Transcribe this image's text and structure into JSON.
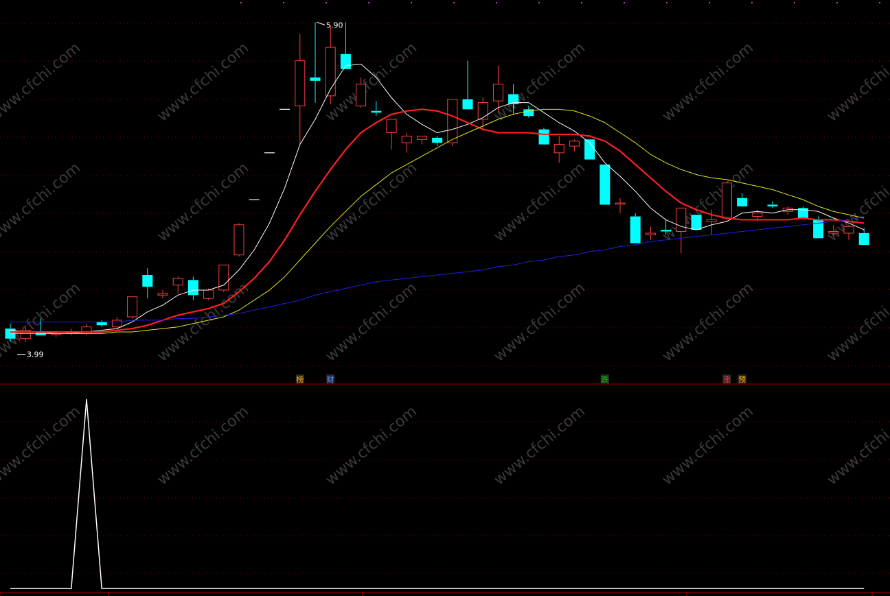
{
  "chart_data": [
    {
      "type": "candlestick",
      "title": "",
      "ylim": [
        3.8,
        6.0
      ],
      "candles": [
        {
          "o": 4.07,
          "h": 4.1,
          "l": 3.99,
          "c": 4.01
        },
        {
          "o": 4.01,
          "h": 4.08,
          "l": 3.99,
          "c": 4.06
        },
        {
          "o": 4.05,
          "h": 4.13,
          "l": 4.03,
          "c": 4.03
        },
        {
          "o": 4.04,
          "h": 4.06,
          "l": 4.02,
          "c": 4.04
        },
        {
          "o": 4.05,
          "h": 4.07,
          "l": 4.03,
          "c": 4.05
        },
        {
          "o": 4.04,
          "h": 4.1,
          "l": 4.03,
          "c": 4.08
        },
        {
          "o": 4.11,
          "h": 4.12,
          "l": 4.08,
          "c": 4.09
        },
        {
          "o": 4.08,
          "h": 4.14,
          "l": 4.07,
          "c": 4.12
        },
        {
          "o": 4.14,
          "h": 4.26,
          "l": 4.13,
          "c": 4.26
        },
        {
          "o": 4.39,
          "h": 4.43,
          "l": 4.25,
          "c": 4.32
        },
        {
          "o": 4.27,
          "h": 4.3,
          "l": 4.25,
          "c": 4.28
        },
        {
          "o": 4.33,
          "h": 4.38,
          "l": 4.28,
          "c": 4.37
        },
        {
          "o": 4.36,
          "h": 4.38,
          "l": 4.24,
          "c": 4.27
        },
        {
          "o": 4.25,
          "h": 4.31,
          "l": 4.24,
          "c": 4.3
        },
        {
          "o": 4.3,
          "h": 4.45,
          "l": 4.29,
          "c": 4.45
        },
        {
          "o": 4.51,
          "h": 4.7,
          "l": 4.5,
          "c": 4.69
        },
        {
          "o": 4.84,
          "h": 4.84,
          "l": 4.84,
          "c": 4.84
        },
        {
          "o": 5.12,
          "h": 5.12,
          "l": 5.12,
          "c": 5.12
        },
        {
          "o": 5.38,
          "h": 5.38,
          "l": 5.38,
          "c": 5.38
        },
        {
          "o": 5.4,
          "h": 5.83,
          "l": 5.17,
          "c": 5.67
        },
        {
          "o": 5.57,
          "h": 5.9,
          "l": 5.42,
          "c": 5.55
        },
        {
          "o": 5.46,
          "h": 5.88,
          "l": 5.41,
          "c": 5.75
        },
        {
          "o": 5.71,
          "h": 5.9,
          "l": 5.65,
          "c": 5.62
        },
        {
          "o": 5.4,
          "h": 5.57,
          "l": 5.39,
          "c": 5.53
        },
        {
          "o": 5.37,
          "h": 5.43,
          "l": 5.34,
          "c": 5.36
        },
        {
          "o": 5.24,
          "h": 5.31,
          "l": 5.14,
          "c": 5.32
        },
        {
          "o": 5.18,
          "h": 5.24,
          "l": 5.12,
          "c": 5.22
        },
        {
          "o": 5.2,
          "h": 5.22,
          "l": 5.17,
          "c": 5.22
        },
        {
          "o": 5.21,
          "h": 5.22,
          "l": 5.16,
          "c": 5.18
        },
        {
          "o": 5.18,
          "h": 5.44,
          "l": 5.16,
          "c": 5.44
        },
        {
          "o": 5.44,
          "h": 5.67,
          "l": 5.38,
          "c": 5.38
        },
        {
          "o": 5.32,
          "h": 5.45,
          "l": 5.25,
          "c": 5.42
        },
        {
          "o": 5.43,
          "h": 5.64,
          "l": 5.36,
          "c": 5.53
        },
        {
          "o": 5.47,
          "h": 5.53,
          "l": 5.35,
          "c": 5.41
        },
        {
          "o": 5.38,
          "h": 5.4,
          "l": 5.33,
          "c": 5.34
        },
        {
          "o": 5.26,
          "h": 5.27,
          "l": 5.17,
          "c": 5.17
        },
        {
          "o": 5.12,
          "h": 5.22,
          "l": 5.06,
          "c": 5.17
        },
        {
          "o": 5.16,
          "h": 5.2,
          "l": 5.13,
          "c": 5.19
        },
        {
          "o": 5.2,
          "h": 5.2,
          "l": 5.08,
          "c": 5.08
        },
        {
          "o": 5.05,
          "h": 5.05,
          "l": 4.81,
          "c": 4.81
        },
        {
          "o": 4.82,
          "h": 4.85,
          "l": 4.76,
          "c": 4.82
        },
        {
          "o": 4.74,
          "h": 4.76,
          "l": 4.58,
          "c": 4.58
        },
        {
          "o": 4.63,
          "h": 4.68,
          "l": 4.6,
          "c": 4.64
        },
        {
          "o": 4.66,
          "h": 4.72,
          "l": 4.63,
          "c": 4.65
        },
        {
          "o": 4.65,
          "h": 4.77,
          "l": 4.52,
          "c": 4.79
        },
        {
          "o": 4.75,
          "h": 4.75,
          "l": 4.66,
          "c": 4.66
        },
        {
          "o": 4.71,
          "h": 4.78,
          "l": 4.63,
          "c": 4.72
        },
        {
          "o": 4.73,
          "h": 4.94,
          "l": 4.71,
          "c": 4.94
        },
        {
          "o": 4.85,
          "h": 4.88,
          "l": 4.8,
          "c": 4.8
        },
        {
          "o": 4.74,
          "h": 4.78,
          "l": 4.71,
          "c": 4.76
        },
        {
          "o": 4.81,
          "h": 4.83,
          "l": 4.79,
          "c": 4.8
        },
        {
          "o": 4.77,
          "h": 4.8,
          "l": 4.75,
          "c": 4.79
        },
        {
          "o": 4.79,
          "h": 4.8,
          "l": 4.74,
          "c": 4.73
        },
        {
          "o": 4.72,
          "h": 4.74,
          "l": 4.61,
          "c": 4.61
        },
        {
          "o": 4.64,
          "h": 4.69,
          "l": 4.62,
          "c": 4.65
        },
        {
          "o": 4.64,
          "h": 4.69,
          "l": 4.6,
          "c": 4.68
        },
        {
          "o": 4.64,
          "h": 4.67,
          "l": 4.57,
          "c": 4.57
        }
      ],
      "price_labels": {
        "high": "5.90",
        "low": "3.99"
      },
      "event_markers": [
        {
          "label": "榜",
          "index": 19,
          "color": "#ffa500"
        },
        {
          "label": "财",
          "index": 21,
          "color": "#4f8fff"
        },
        {
          "label": "跌",
          "index": 39,
          "color": "#00cc00"
        },
        {
          "label": "涨",
          "index": 47,
          "color": "#ff3030"
        },
        {
          "label": "预",
          "index": 48,
          "color": "#ffa500"
        }
      ],
      "series": [
        {
          "color": "#ffffff",
          "values": [
            4.06,
            4.05,
            4.05,
            4.04,
            4.04,
            4.05,
            4.06,
            4.07,
            4.11,
            4.17,
            4.21,
            4.27,
            4.3,
            4.3,
            4.33,
            4.42,
            4.54,
            4.7,
            4.91,
            5.17,
            5.32,
            5.5,
            5.64,
            5.65,
            5.57,
            5.45,
            5.35,
            5.29,
            5.24,
            5.26,
            5.29,
            5.33,
            5.39,
            5.42,
            5.42,
            5.36,
            5.3,
            5.25,
            5.18,
            5.06,
            4.98,
            4.89,
            4.79,
            4.72,
            4.68,
            4.66,
            4.69,
            4.71,
            4.76,
            4.77,
            4.76,
            4.78,
            4.78,
            4.77,
            4.73,
            4.7,
            4.66
          ]
        },
        {
          "color": "#ff2020",
          "values": [
            4.05,
            4.05,
            4.05,
            4.05,
            4.05,
            4.05,
            4.05,
            4.06,
            4.07,
            4.09,
            4.12,
            4.15,
            4.17,
            4.19,
            4.22,
            4.29,
            4.37,
            4.47,
            4.6,
            4.75,
            4.89,
            5.02,
            5.14,
            5.24,
            5.3,
            5.35,
            5.37,
            5.38,
            5.37,
            5.34,
            5.3,
            5.26,
            5.24,
            5.24,
            5.24,
            5.23,
            5.23,
            5.23,
            5.22,
            5.19,
            5.13,
            5.05,
            4.97,
            4.89,
            4.82,
            4.78,
            4.75,
            4.73,
            4.72,
            4.72,
            4.72,
            4.72,
            4.73,
            4.72,
            4.72,
            4.71,
            4.7
          ]
        },
        {
          "color": "#e6e620",
          "values": [
            4.04,
            4.04,
            4.04,
            4.04,
            4.04,
            4.04,
            4.04,
            4.05,
            4.05,
            4.06,
            4.07,
            4.08,
            4.1,
            4.12,
            4.14,
            4.18,
            4.24,
            4.3,
            4.38,
            4.48,
            4.58,
            4.68,
            4.77,
            4.86,
            4.93,
            5.0,
            5.05,
            5.1,
            5.15,
            5.2,
            5.24,
            5.28,
            5.32,
            5.35,
            5.37,
            5.38,
            5.38,
            5.37,
            5.34,
            5.3,
            5.24,
            5.18,
            5.11,
            5.06,
            5.02,
            4.99,
            4.97,
            4.96,
            4.94,
            4.92,
            4.9,
            4.87,
            4.84,
            4.8,
            4.77,
            4.75,
            4.73
          ]
        },
        {
          "color": "#2020e0",
          "values": [
            4.11,
            4.11,
            4.11,
            4.11,
            4.11,
            4.11,
            4.11,
            4.11,
            4.12,
            4.12,
            4.12,
            4.13,
            4.13,
            4.14,
            4.15,
            4.16,
            4.18,
            4.2,
            4.22,
            4.24,
            4.27,
            4.29,
            4.31,
            4.33,
            4.35,
            4.36,
            4.37,
            4.38,
            4.39,
            4.4,
            4.41,
            4.42,
            4.44,
            4.45,
            4.47,
            4.48,
            4.5,
            4.51,
            4.53,
            4.54,
            4.56,
            4.57,
            4.59,
            4.6,
            4.61,
            4.62,
            4.63,
            4.64,
            4.65,
            4.66,
            4.67,
            4.68,
            4.69,
            4.7,
            4.71,
            4.72,
            4.74
          ]
        }
      ]
    },
    {
      "type": "line",
      "title": "",
      "ylim": [
        0,
        1
      ],
      "series": [
        {
          "color": "#ffffff",
          "values": [
            0,
            0,
            0,
            0,
            0,
            1,
            0,
            0,
            0,
            0,
            0,
            0,
            0,
            0,
            0,
            0,
            0,
            0,
            0,
            0,
            0,
            0,
            0,
            0,
            0,
            0,
            0,
            0,
            0,
            0,
            0,
            0,
            0,
            0,
            0,
            0,
            0,
            0,
            0,
            0,
            0,
            0,
            0,
            0,
            0,
            0,
            0,
            0,
            0,
            0,
            0,
            0,
            0,
            0,
            0,
            0,
            0
          ]
        }
      ]
    }
  ],
  "watermark": "www.cfchi.com",
  "colors": {
    "up": "#ff4040",
    "down": "#00ffff",
    "grid": "#800000",
    "axis": "#b00000",
    "background": "#000000"
  }
}
